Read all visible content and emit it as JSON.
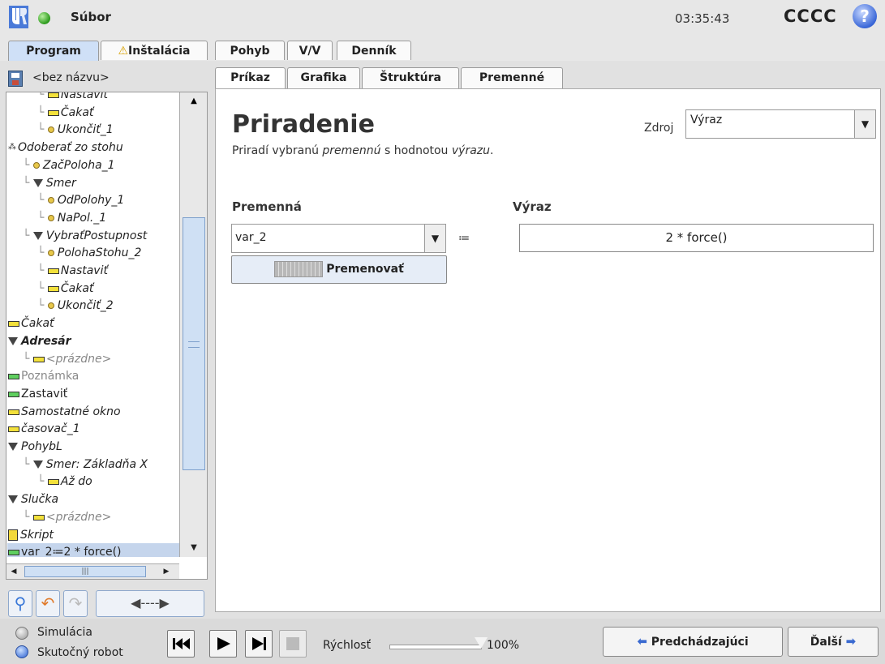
{
  "header": {
    "file_menu": "Súbor",
    "clock": "03:35:43",
    "robot_name": "CCCC",
    "help": "?"
  },
  "main_tabs": [
    {
      "label": "Program",
      "active": true
    },
    {
      "label": "Inštalácia",
      "warning": true
    },
    {
      "label": "Pohyb"
    },
    {
      "label": "V/V"
    },
    {
      "label": "Denník"
    }
  ],
  "program": {
    "name": "<bez názvu>"
  },
  "tree": [
    {
      "label": "Nastaviť",
      "icon": "bar",
      "indent": 2,
      "italic": true
    },
    {
      "label": "Čakať",
      "icon": "bar",
      "indent": 2,
      "italic": true
    },
    {
      "label": "Ukončiť_1",
      "icon": "dot",
      "indent": 2,
      "italic": true
    },
    {
      "label": "Odoberať zo stohu",
      "icon": "multi",
      "indent": 0,
      "italic": true
    },
    {
      "label": "ZačPoloha_1",
      "icon": "dot",
      "indent": 1,
      "italic": true
    },
    {
      "label": "Smer",
      "icon": "tri",
      "indent": 1,
      "italic": true
    },
    {
      "label": "OdPolohy_1",
      "icon": "dot",
      "indent": 2,
      "italic": true
    },
    {
      "label": "NaPol._1",
      "icon": "dot",
      "indent": 2,
      "italic": true
    },
    {
      "label": "VybraťPostupnost",
      "icon": "tri",
      "indent": 1,
      "italic": true
    },
    {
      "label": "PolohaStohu_2",
      "icon": "dot",
      "indent": 2,
      "italic": true
    },
    {
      "label": "Nastaviť",
      "icon": "bar",
      "indent": 2,
      "italic": true
    },
    {
      "label": "Čakať",
      "icon": "bar",
      "indent": 2,
      "italic": true
    },
    {
      "label": "Ukončiť_2",
      "icon": "dot",
      "indent": 2,
      "italic": true
    },
    {
      "label": "Čakať",
      "icon": "bar",
      "indent": 0,
      "italic": true
    },
    {
      "label": "Adresár",
      "icon": "tri",
      "indent": 0,
      "italic": true,
      "bold": true
    },
    {
      "label": "<prázdne>",
      "icon": "bar",
      "indent": 1,
      "italic": true,
      "gray": true
    },
    {
      "label": "Poznámka",
      "icon": "bar-green",
      "indent": 0,
      "gray": true
    },
    {
      "label": "Zastaviť",
      "icon": "bar-green",
      "indent": 0
    },
    {
      "label": "Samostatné okno",
      "icon": "bar",
      "indent": 0,
      "italic": true
    },
    {
      "label": "časovač_1",
      "icon": "bar",
      "indent": 0,
      "italic": true
    },
    {
      "label": "PohybL",
      "icon": "tri",
      "indent": 0,
      "italic": true
    },
    {
      "label": "Smer: Základňa X",
      "icon": "tri",
      "indent": 1,
      "italic": true
    },
    {
      "label": "Až do",
      "icon": "bar",
      "indent": 2,
      "italic": true
    },
    {
      "label": "Slučka",
      "icon": "tri",
      "indent": 0,
      "italic": true
    },
    {
      "label": "<prázdne>",
      "icon": "bar",
      "indent": 1,
      "italic": true,
      "gray": true
    },
    {
      "label": "Skript",
      "icon": "script",
      "indent": 0,
      "italic": true
    },
    {
      "label": "var_2≔2 * force()",
      "icon": "bar-green",
      "indent": 0,
      "selected": true
    }
  ],
  "subtabs": [
    {
      "label": "Príkaz",
      "active": true
    },
    {
      "label": "Grafika"
    },
    {
      "label": "Štruktúra"
    },
    {
      "label": "Premenné"
    }
  ],
  "command": {
    "title": "Priradenie",
    "desc_pre": "Priradí vybranú ",
    "desc_var": "premennú",
    "desc_mid": " s hodnotou ",
    "desc_expr": "výrazu",
    "desc_end": ".",
    "source_label": "Zdroj",
    "source_value": "Výraz",
    "variable_label": "Premenná",
    "variable_value": "var_2",
    "assign_op": "≔",
    "expression_label": "Výraz",
    "expression_value": "2 * force()",
    "rename_label": "Premenovať"
  },
  "bottom": {
    "simulation_label": "Simulácia",
    "real_robot_label": "Skutočný robot",
    "mode": "real_robot",
    "speed_label": "Rýchlosť",
    "speed_value": "100%",
    "speed_fraction": 1.0,
    "prev_label": "Predchádzajúci",
    "next_label": "Ďalší"
  }
}
